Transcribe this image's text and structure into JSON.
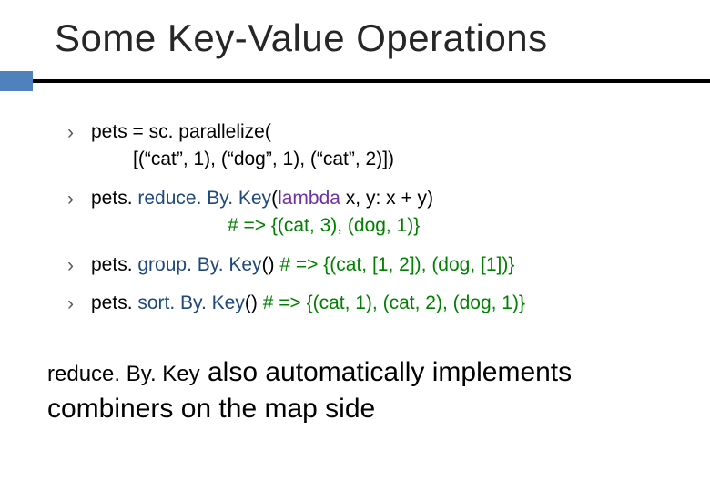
{
  "title": "Some Key-Value Operations",
  "bullets": {
    "b1": {
      "line1": "pets = sc. parallelize(",
      "line2": "[(“cat”, 1), (“dog”, 1), (“cat”, 2)])"
    },
    "b2": {
      "pre": "pets. ",
      "method": "reduce. By. Key",
      "paren_open": "(",
      "kw": "lambda",
      "args": " x, y: x + y",
      "paren_close": ")",
      "comment": "# => {(cat, 3), (dog, 1)}"
    },
    "b3": {
      "pre": "pets. ",
      "method": "group. By. Key",
      "after": "() ",
      "comment": "# => {(cat, [1, 2]), (dog, [1])}"
    },
    "b4": {
      "pre": "pets. ",
      "method": "sort. By. Key",
      "after": "() ",
      "comment": " # => {(cat, 1), (cat, 2), (dog, 1)}"
    }
  },
  "footer": {
    "code": "reduce. By. Key",
    "rest": " also automatically implements combiners on the map side"
  }
}
